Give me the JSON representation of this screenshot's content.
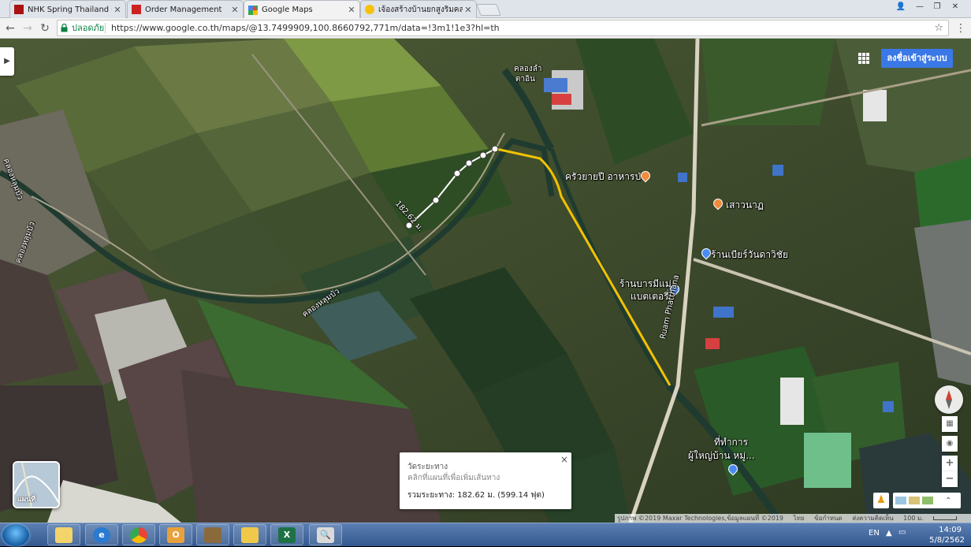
{
  "browser": {
    "tabs": [
      {
        "title": "NHK Spring Thailand Co",
        "favicon_color": "#cc2222",
        "active": false
      },
      {
        "title": "Order Management",
        "favicon_color": "#cc2222",
        "active": false
      },
      {
        "title": "Google Maps",
        "favicon_color": "#34a853",
        "active": true
      },
      {
        "title": "เจ้องสร้างบ้านยกสูงริมคลอง -",
        "favicon_color": "#f4c20d",
        "active": false
      }
    ],
    "secure_label": "ปลอดภัย",
    "url": "https://www.google.co.th/maps/@13.7499909,100.8660792,771m/data=!3m1!1e3?hl=th"
  },
  "map": {
    "signin_label": "ลงชื่อเข้าสู่ระบบ",
    "thumbnail_label": "แผนที่",
    "labels": {
      "canal_top_1": "คลองลำ",
      "canal_top_2": "ตาอิน",
      "restaurant": "ครัวยายปี อาหารป่า",
      "sao": "เสาวนาฏ",
      "beer_shop": "ร้านเบียร์วันดาวิชัย",
      "bari_1": "ร้านบารมีแม่",
      "bari_2": "แบตเตอรี่",
      "village_1": "ที่ทำการ",
      "village_2": "ผู้ใหญ่บ้าน หมู่...",
      "road": "Ruam Phatthana",
      "canal_left": "คลองหลุมบัว",
      "canal_mid": "คลองหลุมบัว",
      "canal_left2": "คลองหลุมบัว",
      "measure_len": "182.62 ม."
    },
    "measure_box": {
      "title": "วัดระยะทาง",
      "hint": "คลิกที่แผนที่เพื่อเพิ่มเส้นทาง",
      "total": "รวมระยะทาง: 182.62 ม. (599.14 ฟุต)",
      "close": "×"
    },
    "attribution": {
      "imagery": "รูปภาพ ©2019 Maxar Technologies,ข้อมูลแผนที่ ©2019",
      "country": "ไทย",
      "terms": "ข้อกำหนด",
      "feedback": "ส่งความคิดเห็น",
      "scale": "100 ม."
    },
    "colors": {
      "route": "#f2c200",
      "measure": "#ffffff",
      "signin": "#3b78e7"
    }
  },
  "taskbar": {
    "language": "EN",
    "time": "14:09",
    "date": "5/8/2562"
  }
}
